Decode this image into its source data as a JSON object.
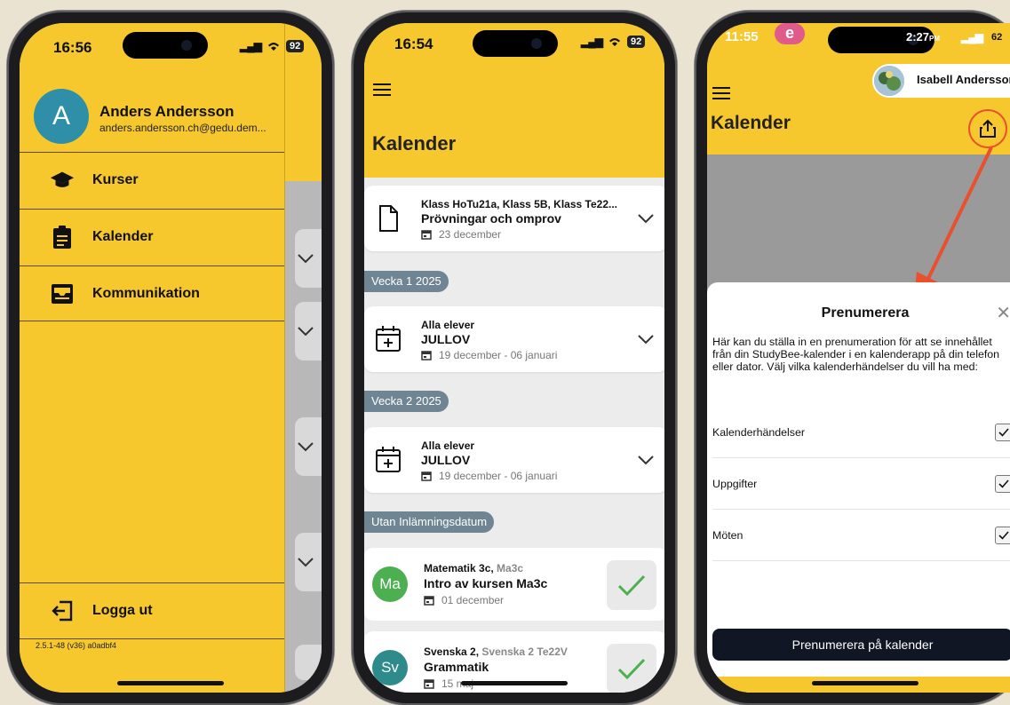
{
  "phone1": {
    "status_time": "16:56",
    "battery": "92",
    "user": {
      "initial": "A",
      "name": "Anders Andersson",
      "email": "anders.andersson.ch@gedu.dem..."
    },
    "menu": [
      {
        "label": "Kurser",
        "icon": "graduation-cap-icon"
      },
      {
        "label": "Kalender",
        "icon": "clipboard-icon"
      },
      {
        "label": "Kommunikation",
        "icon": "inbox-icon"
      }
    ],
    "logout_label": "Logga ut",
    "version": "2.5.1-48 (v36) a0adbf4"
  },
  "phone2": {
    "status_time": "16:54",
    "battery": "92",
    "title": "Kalender",
    "events": [
      {
        "who": "Klass HoTu21a, Klass 5B, Klass Te22...",
        "what": "Prövningar och omprov",
        "date": "23 december"
      },
      {
        "who": "Alla elever",
        "what": "JULLOV",
        "date": "19 december - 06 januari"
      },
      {
        "who": "Alla elever",
        "what": "JULLOV",
        "date": "19 december - 06 januari"
      }
    ],
    "weeks": [
      {
        "label": "Vecka 1  2025"
      },
      {
        "label": "Vecka 2  2025"
      },
      {
        "label": "Utan Inlämningsdatum"
      }
    ],
    "tasks": [
      {
        "initials": "Ma",
        "course": "Matematik 3c,",
        "group": "Ma3c",
        "name": "Intro av kursen Ma3c",
        "date": "01 december",
        "color": "#4caf50"
      },
      {
        "initials": "Sv",
        "course": "Svenska 2,",
        "group": "Svenska 2 Te22V",
        "name": "Grammatik",
        "date": "15 maj",
        "color": "#2e8b8b"
      }
    ]
  },
  "phone3": {
    "status_time": "11:55",
    "clock": "2:27",
    "clock_suffix": "PM",
    "battery": "62",
    "user_name": "Isabell Andersson",
    "title": "Kalender",
    "sheet": {
      "title": "Prenumerera",
      "description": "Här kan du ställa in en prenumeration för att se innehållet från din StudyBee-kalender i en kalenderapp på din telefon eller dator. Välj vilka kalenderhändelser du vill ha med:",
      "options": [
        {
          "label": "Kalenderhändelser",
          "checked": true
        },
        {
          "label": "Uppgifter",
          "checked": true
        },
        {
          "label": "Möten",
          "checked": true
        }
      ],
      "button": "Prenumerera på kalender"
    }
  },
  "colors": {
    "brand_yellow": "#f6c82d",
    "dark_button": "#111624",
    "arrow": "#e8502e",
    "check_green": "#4caf50"
  }
}
